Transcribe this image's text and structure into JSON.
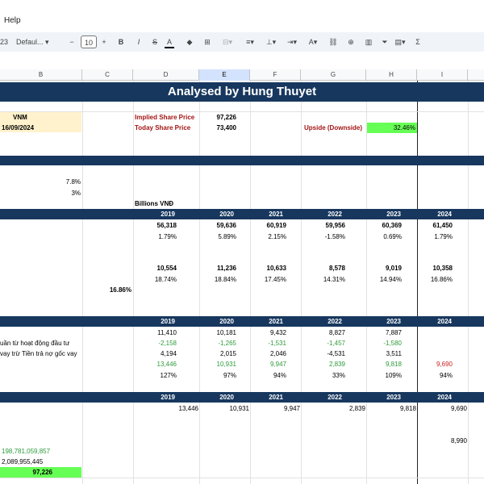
{
  "menu": {
    "help": "Help"
  },
  "toolbar": {
    "font_name": "Defaul...",
    "font_size": "10",
    "bold": "B",
    "italic": "I",
    "strike": "S",
    "text_color": "A",
    "sum": "Σ",
    "zoom_tail": "23"
  },
  "columns": [
    "B",
    "C",
    "D",
    "E",
    "F",
    "G",
    "H",
    "I"
  ],
  "title": "Analysed by Hung Thuyet",
  "ticker": "VNM",
  "date": "16/09/2024",
  "implied_label": "Implied Share Price",
  "implied_value": "97,226",
  "today_label": "Today Share Price",
  "today_value": "73,400",
  "upside_label": "Upside (Downside)",
  "upside_value": "32.46%",
  "assump1": "7.8%",
  "assump2": "3%",
  "units": "Billions VNĐ",
  "years": [
    "2019",
    "2020",
    "2021",
    "2022",
    "2023",
    "2024"
  ],
  "revenue": [
    "56,318",
    "59,636",
    "60,919",
    "59,956",
    "60,369",
    "61,450"
  ],
  "revenue_growth": [
    "1.79%",
    "5.89%",
    "2.15%",
    "-1.58%",
    "0.69%",
    "1.79%"
  ],
  "ebit": [
    "10,554",
    "11,236",
    "10,633",
    "8,578",
    "9,019",
    "10,358"
  ],
  "ebit_margin": [
    "18.74%",
    "18.84%",
    "17.45%",
    "14.31%",
    "14.94%",
    "16.86%"
  ],
  "avg_margin": "16.86%",
  "cf_label1": "uần từ hoạt động đầu tư",
  "cf_label2": "vay trừ Tiền trả nợ gốc vay",
  "cf_row1": [
    "11,410",
    "10,181",
    "9,432",
    "8,827",
    "7,887",
    ""
  ],
  "cf_row2": [
    "-2,158",
    "-1,265",
    "-1,531",
    "-1,457",
    "-1,580",
    ""
  ],
  "cf_row3": [
    "4,194",
    "2,015",
    "2,046",
    "-4,531",
    "3,511",
    ""
  ],
  "cf_row4": [
    "13,446",
    "10,931",
    "9,947",
    "2,839",
    "9,818",
    "9,690"
  ],
  "cf_row5": [
    "127%",
    "97%",
    "94%",
    "33%",
    "109%",
    "94%"
  ],
  "fcf": [
    "13,446",
    "10,931",
    "9,947",
    "2,839",
    "9,818",
    "9,690"
  ],
  "terminal": "8,990",
  "ev": "198,781,059,857",
  "shares": "2,089,955,445",
  "price": "97,226",
  "colors": {
    "navy": "#17375e",
    "highlight_yellow": "#fff2cc",
    "highlight_green": "#66ff55",
    "dark_red": "#a31515"
  }
}
